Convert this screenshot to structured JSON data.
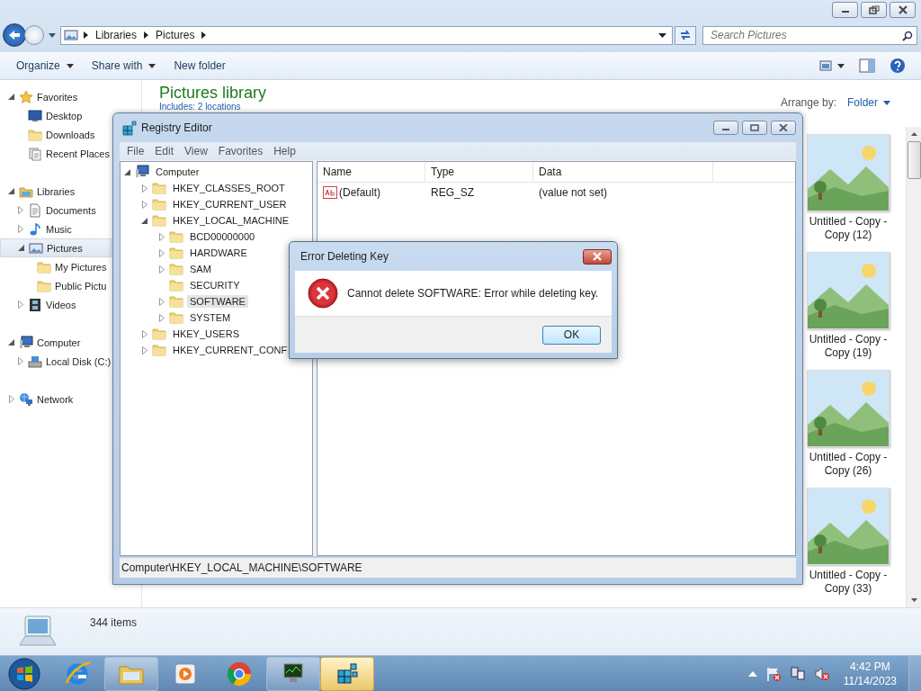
{
  "explorer": {
    "breadcrumb": [
      "Libraries",
      "Pictures"
    ],
    "search": {
      "placeholder": "Search Pictures"
    },
    "commands": [
      {
        "label": "Organize",
        "menu": true
      },
      {
        "label": "Share with",
        "menu": true
      },
      {
        "label": "New folder",
        "menu": false
      }
    ],
    "nav": [
      {
        "label": "Favorites",
        "kind": "star",
        "expanded": true,
        "selected": false,
        "children": [
          {
            "label": "Desktop",
            "kind": "desktop",
            "selected": false
          },
          {
            "label": "Downloads",
            "kind": "folder",
            "selected": false
          },
          {
            "label": "Recent Places",
            "kind": "recent",
            "selected": false
          }
        ]
      },
      {
        "label": "Libraries",
        "kind": "library",
        "expanded": true,
        "selected": false,
        "children": [
          {
            "label": "Documents",
            "kind": "document",
            "expanded": false,
            "selected": false
          },
          {
            "label": "Music",
            "kind": "music",
            "expanded": false,
            "selected": false
          },
          {
            "label": "Pictures",
            "kind": "pictures",
            "expanded": true,
            "selected": true,
            "children": [
              {
                "label": "My Pictures",
                "kind": "folder",
                "selected": false
              },
              {
                "label": "Public Pictu",
                "kind": "folder",
                "selected": false
              }
            ]
          },
          {
            "label": "Videos",
            "kind": "video",
            "expanded": false,
            "selected": false
          }
        ]
      },
      {
        "label": "Computer",
        "kind": "computer",
        "expanded": true,
        "selected": false,
        "children": [
          {
            "label": "Local Disk (C:)",
            "kind": "disk",
            "expanded": false,
            "selected": false
          }
        ]
      },
      {
        "label": "Network",
        "kind": "network",
        "expanded": false,
        "selected": false
      }
    ],
    "library_title": "Pictures library",
    "includes": "Includes: 2 locations",
    "arrange_label": "Arrange by:",
    "arrange_value": "Folder",
    "items": [
      {
        "name": "Untitled - Copy - Copy (12)",
        "kind": "picture"
      },
      {
        "name": "Untitled - Copy - Copy (19)",
        "kind": "picture"
      },
      {
        "name": "Untitled - Copy - Copy (26)",
        "kind": "picture"
      },
      {
        "name": "Untitled - Copy - Copy (33)",
        "kind": "picture"
      }
    ],
    "item_count": "344 items"
  },
  "registry": {
    "title": "Registry Editor",
    "menu": [
      "File",
      "Edit",
      "View",
      "Favorites",
      "Help"
    ],
    "tree": [
      {
        "label": "Computer",
        "kind": "computer",
        "expanded": true,
        "selected": false,
        "children": [
          {
            "label": "HKEY_CLASSES_ROOT",
            "kind": "folder",
            "expanded": false,
            "selected": false
          },
          {
            "label": "HKEY_CURRENT_USER",
            "kind": "folder",
            "expanded": false,
            "selected": false
          },
          {
            "label": "HKEY_LOCAL_MACHINE",
            "kind": "folder",
            "expanded": true,
            "selected": false,
            "children": [
              {
                "label": "BCD00000000",
                "kind": "folder",
                "expanded": false,
                "selected": false
              },
              {
                "label": "HARDWARE",
                "kind": "folder",
                "expanded": false,
                "selected": false
              },
              {
                "label": "SAM",
                "kind": "folder",
                "expanded": false,
                "selected": false
              },
              {
                "label": "SECURITY",
                "kind": "folder",
                "selected": false
              },
              {
                "label": "SOFTWARE",
                "kind": "folder",
                "expanded": false,
                "selected": true
              },
              {
                "label": "SYSTEM",
                "kind": "folder",
                "expanded": false,
                "selected": false
              }
            ]
          },
          {
            "label": "HKEY_USERS",
            "kind": "folder",
            "expanded": false,
            "selected": false
          },
          {
            "label": "HKEY_CURRENT_CONF",
            "kind": "folder",
            "expanded": false,
            "selected": false
          }
        ]
      }
    ],
    "columns": [
      "Name",
      "Type",
      "Data"
    ],
    "values": [
      {
        "name": "(Default)",
        "type": "REG_SZ",
        "data": "(value not set)"
      }
    ],
    "status": "Computer\\HKEY_LOCAL_MACHINE\\SOFTWARE"
  },
  "dialog": {
    "title": "Error Deleting Key",
    "message": "Cannot delete SOFTWARE:  Error while deleting key.",
    "button": "OK"
  },
  "taskbar": {
    "apps": [
      {
        "kind": "ie",
        "open": false,
        "selected": false
      },
      {
        "kind": "explorer",
        "open": true,
        "selected": false
      },
      {
        "kind": "media",
        "open": false,
        "selected": false
      },
      {
        "kind": "chrome",
        "open": false,
        "selected": false
      },
      {
        "kind": "taskmgr",
        "open": true,
        "selected": false
      },
      {
        "kind": "regedit",
        "open": true,
        "selected": true
      }
    ],
    "time": "4:42 PM",
    "date": "11/14/2023"
  }
}
